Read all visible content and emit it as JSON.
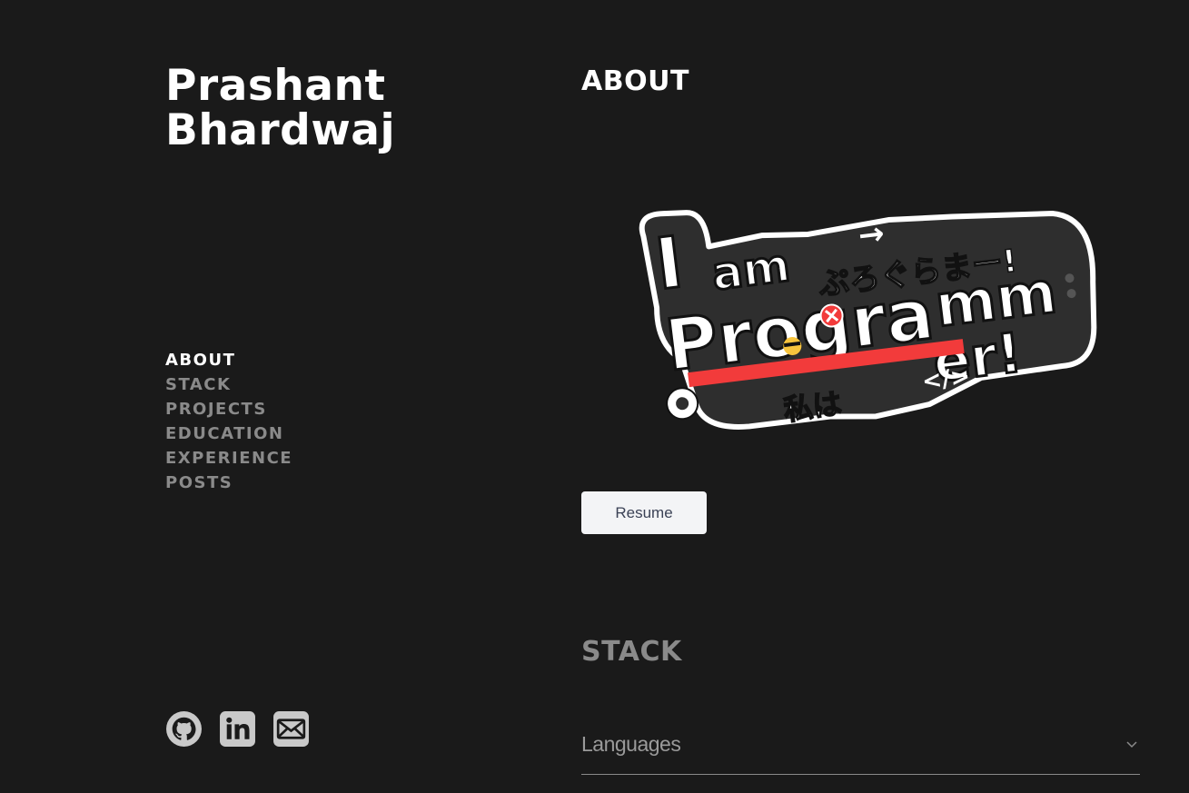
{
  "profile": {
    "first_name": "Prashant",
    "last_name": "Bhardwaj"
  },
  "nav": {
    "items": [
      {
        "label": "ABOUT",
        "active": true
      },
      {
        "label": "STACK",
        "active": false
      },
      {
        "label": "PROJECTS",
        "active": false
      },
      {
        "label": "EDUCATION",
        "active": false
      },
      {
        "label": "EXPERIENCE",
        "active": false
      },
      {
        "label": "POSTS",
        "active": false
      }
    ]
  },
  "socials": [
    {
      "name": "github-icon"
    },
    {
      "name": "linkedin-icon"
    },
    {
      "name": "email-icon"
    }
  ],
  "about": {
    "title": "ABOUT",
    "sticker": {
      "line1": "I am",
      "line2": "Programmer!",
      "japanese_top": "ぷろぐらまー!",
      "japanese_bottom": "私は",
      "code_tag": "</>",
      "arrow": "→",
      "emoji": "😎"
    },
    "resume_label": "Resume"
  },
  "stack": {
    "title": "STACK",
    "accordion_label": "Languages"
  },
  "colors": {
    "background": "#1a1a1a",
    "text_active": "#ffffff",
    "text_muted": "#8a8a8a",
    "button_bg": "#f3f4f6",
    "button_text": "#3b4256",
    "sticker_red": "#f23b3b",
    "sticker_dark": "#2e2e2e"
  }
}
